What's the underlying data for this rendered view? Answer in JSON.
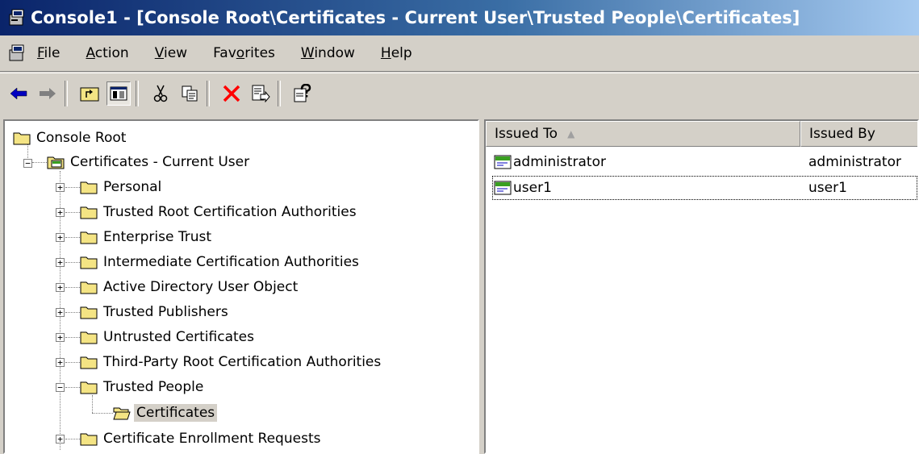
{
  "window": {
    "title": "Console1 - [Console Root\\Certificates - Current User\\Trusted People\\Certificates]"
  },
  "menu": [
    {
      "label": "File",
      "mnemonic": "F",
      "rest": "ile"
    },
    {
      "label": "Action",
      "mnemonic": "A",
      "rest": "ction"
    },
    {
      "label": "View",
      "mnemonic": "V",
      "rest": "iew"
    },
    {
      "label": "Favorites",
      "pre": "Fav",
      "mnemonic": "o",
      "rest": "rites"
    },
    {
      "label": "Window",
      "mnemonic": "W",
      "rest": "indow"
    },
    {
      "label": "Help",
      "mnemonic": "H",
      "rest": "elp"
    }
  ],
  "toolbar": {
    "buttons": [
      "back-arrow-icon",
      "forward-arrow-icon",
      "up-folder-icon",
      "show-hide-tree-icon",
      "cut-icon",
      "copy-icon",
      "delete-icon",
      "export-list-icon",
      "help-icon"
    ]
  },
  "tree": {
    "root": "Console Root",
    "snapin": "Certificates - Current User",
    "stores": [
      "Personal",
      "Trusted Root Certification Authorities",
      "Enterprise Trust",
      "Intermediate Certification Authorities",
      "Active Directory User Object",
      "Trusted Publishers",
      "Untrusted Certificates",
      "Third-Party Root Certification Authorities",
      "Trusted People"
    ],
    "selected_child": "Certificates",
    "last_store": "Certificate Enrollment Requests"
  },
  "list": {
    "columns": [
      "Issued To",
      "Issued By"
    ],
    "rows": [
      {
        "issued_to": "administrator",
        "issued_by": "administrator"
      },
      {
        "issued_to": "user1",
        "issued_by": "user1"
      }
    ]
  },
  "colors": {
    "title_gradient_start": "#0a246a",
    "title_gradient_end": "#a6caf0",
    "face": "#d4d0c8",
    "delete_red": "#ff0000"
  }
}
